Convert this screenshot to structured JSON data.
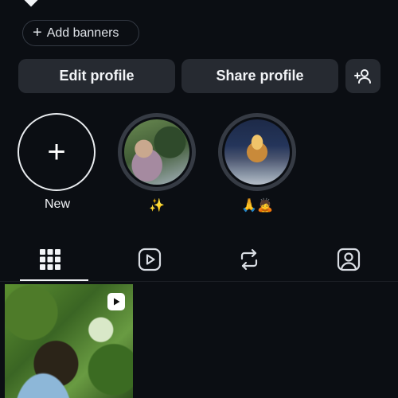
{
  "banner": {
    "label": "Add banners",
    "plus": "+"
  },
  "buttons": {
    "edit_label": "Edit profile",
    "share_label": "Share profile",
    "add_person_icon": "add-person-icon"
  },
  "highlights": [
    {
      "label": "New",
      "icon": "plus"
    },
    {
      "label": "✨"
    },
    {
      "label": "🙏🙇"
    }
  ],
  "tabs": [
    {
      "icon": "grid-icon",
      "selected": true
    },
    {
      "icon": "reels-icon",
      "selected": false
    },
    {
      "icon": "repost-icon",
      "selected": false
    },
    {
      "icon": "tagged-icon",
      "selected": false
    }
  ],
  "colors": {
    "background": "#0b0e13",
    "button_bg": "#262a31",
    "text": "#f2f4f7"
  }
}
